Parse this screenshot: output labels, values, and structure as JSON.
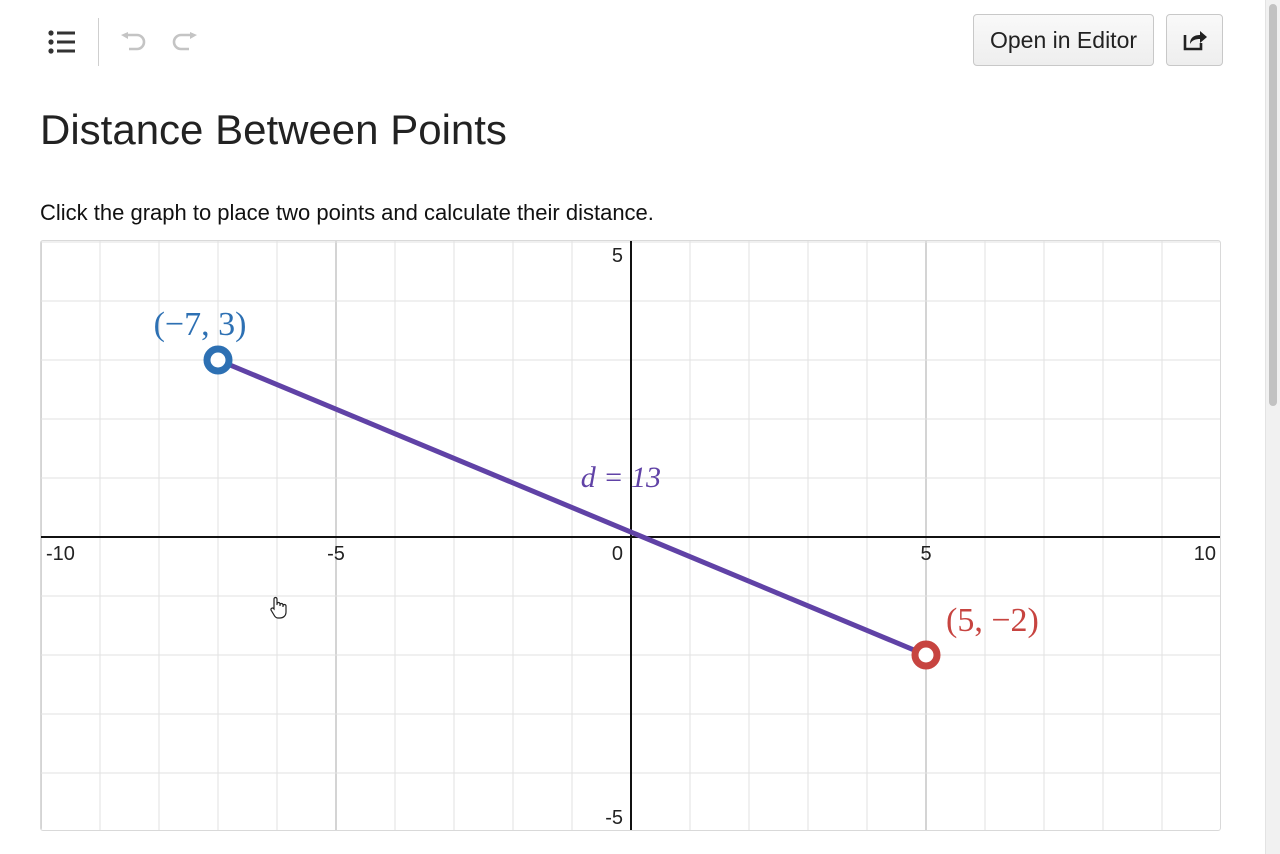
{
  "toolbar": {
    "list_icon": "list-icon",
    "undo_icon": "undo-icon",
    "redo_icon": "redo-icon",
    "open_editor_label": "Open in Editor",
    "share_icon": "share-icon"
  },
  "page": {
    "title": "Distance Between Points",
    "instruction": "Click the graph to place two points and calculate their distance."
  },
  "graph": {
    "x_range": [
      -10,
      10
    ],
    "y_range": [
      -5,
      5
    ],
    "grid": true,
    "x_tick_labels": [
      "-10",
      "-5",
      "0",
      "5",
      "10"
    ],
    "y_tick_labels": [
      "5",
      "-5"
    ],
    "point_a": {
      "x": -7,
      "y": 3,
      "label": "(−7, 3)",
      "color": "#2d70b3"
    },
    "point_b": {
      "x": 5,
      "y": -2,
      "label": "(5, −2)",
      "color": "#c74440"
    },
    "segment_color": "#6042a6",
    "distance_label": "d = 13"
  }
}
